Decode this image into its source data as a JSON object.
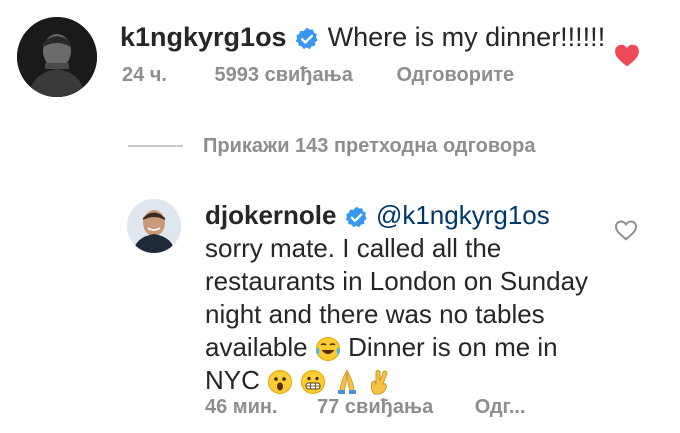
{
  "comment1": {
    "username": "k1ngkyrg1os",
    "verified": true,
    "text": "Where is my dinner!!!!!!",
    "time": "24 ч.",
    "likes": "5993 свиђања",
    "reply_label": "Одговорите",
    "liked": true
  },
  "view_replies": "Прикажи 143 претходна одговора",
  "comment2": {
    "username": "djokernole",
    "verified": true,
    "mention": "@k1ngkyrg1os",
    "text_1": "sorry mate. I called all the restaurants in London on Sunday night and there was no tables available",
    "text_2": "Dinner is on me in NYC",
    "time": "46 мин.",
    "likes": "77 свиђања",
    "reply_label": "Одг...",
    "liked": false
  },
  "colors": {
    "text": "#262626",
    "meta": "#8e8e8e",
    "verified_badge": "#3897f0",
    "heart_liked": "#ed4956",
    "mention": "#00376b"
  },
  "icons": {
    "verified": "verified-badge-icon",
    "liked_heart": "heart-filled-icon",
    "unliked_heart": "heart-outline-icon",
    "emoji_1": "tears-of-joy-emoji",
    "emoji_2": "astonished-face-emoji",
    "emoji_3": "grimacing-face-emoji",
    "emoji_4": "folded-hands-emoji",
    "emoji_5": "crossed-fingers-emoji"
  }
}
